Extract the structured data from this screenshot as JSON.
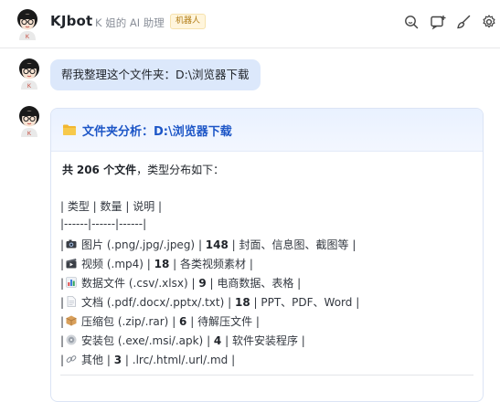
{
  "header": {
    "bot_name": "KJbot",
    "subtitle": "K 姐的 AI 助理",
    "badge": "机器人",
    "icons": [
      "search-icon",
      "add-chat-icon",
      "clean-icon",
      "settings-icon"
    ]
  },
  "user_message": {
    "text": "帮我整理这个文件夹：D:\\浏览器下载"
  },
  "bot_message": {
    "title": "文件夹分析：D:\\浏览器下载",
    "summary_prefix": "共",
    "summary_count": "206 个文件",
    "summary_suffix": "，类型分布如下：",
    "table_header": "| 类型 | 数量 | 说明 |",
    "table_separator": "|------|------|------|",
    "rows": [
      {
        "icon": "camera-icon",
        "type": "图片 (.png/.jpg/.jpeg)",
        "count": "148",
        "desc": "封面、信息图、截图等"
      },
      {
        "icon": "video-icon",
        "type": "视频 (.mp4)",
        "count": "18",
        "desc": "各类视频素材"
      },
      {
        "icon": "bar-chart-icon",
        "type": "数据文件 (.csv/.xlsx)",
        "count": "9",
        "desc": "电商数据、表格"
      },
      {
        "icon": "document-icon",
        "type": "文档 (.pdf/.docx/.pptx/.txt)",
        "count": "18",
        "desc": "PPT、PDF、Word"
      },
      {
        "icon": "package-icon",
        "type": "压缩包 (.zip/.rar)",
        "count": "6",
        "desc": "待解压文件"
      },
      {
        "icon": "installer-icon",
        "type": "安装包 (.exe/.msi/.apk)",
        "count": "4",
        "desc": "软件安装程序"
      },
      {
        "icon": "link-icon",
        "type": "其他",
        "count": "3",
        "desc": ".lrc/.html/.url/.md"
      }
    ]
  },
  "colors": {
    "accent": "#1d56c7",
    "user_bubble": "#dce8fb",
    "card_head": "#e9f1ff",
    "badge_bg": "#fff5dc",
    "badge_text": "#b07a12"
  }
}
